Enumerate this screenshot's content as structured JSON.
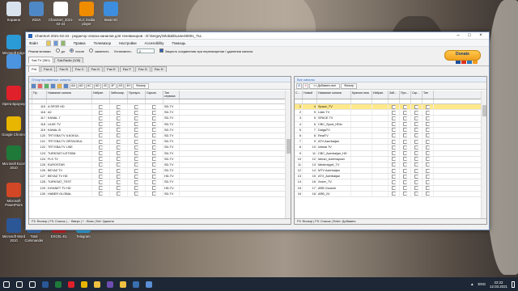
{
  "desktop": {
    "icons": [
      {
        "label": "Корзина",
        "color": "#d9e3ee"
      },
      {
        "label": "ИЗЗА",
        "color": "#4f88c6"
      },
      {
        "label": "ChanSort_2021-02-24",
        "color": "#ffffff"
      },
      {
        "label": "VLC media player",
        "color": "#f08c00"
      },
      {
        "label": "Киви HD",
        "color": "#3d8ede"
      },
      {
        "label": "Microsoft Edge",
        "color": "#2b9bd8"
      },
      {
        "label": "",
        "color": "#4d94e0"
      },
      {
        "label": "Opera Браузер",
        "color": "#e0202a"
      },
      {
        "label": "Google Chrome",
        "color": "#e8b500"
      },
      {
        "label": "Microsoft Excel 2010",
        "color": "#1f7a3a"
      },
      {
        "label": "Microsoft PowerPoint",
        "color": "#d24726"
      },
      {
        "label": "Microsoft Word 2010",
        "color": "#2b5797"
      },
      {
        "label": "Total Commander",
        "color": "#3a6fb0"
      },
      {
        "label": "EXCEL-EL",
        "color": "#c42121"
      },
      {
        "label": "Telegram",
        "color": "#2ea6df"
      }
    ]
  },
  "window": {
    "title": "ChanSort 2021-02-24 - редактор списка каналов для телевизоров - D:\\Sergey\\GlobalDLanes\\0001_TLL",
    "menu": [
      "Файл",
      "Правка",
      "Телевизор",
      "Настройки",
      "Accessibility",
      "Помощь"
    ],
    "options": {
      "mode_label": "Режим вставки",
      "radio_before": "до",
      "radio_after": "после",
      "radio_replace": "заменить",
      "set_label": "Установить:",
      "set_value": "2",
      "close_gaps": "Закрыть соединения при перемещении / удалении канала"
    },
    "donate": "Donate",
    "source_tabs": [
      "Sat-TV (381)",
      "Sat-Radio (108)"
    ],
    "fav_tabs": [
      "Pr#",
      "Fav A",
      "Fav B",
      "Fav C",
      "Fav D",
      "Fav E",
      "Fav F",
      "Fav G",
      "Fav H"
    ],
    "left": {
      "title": "Отсортированные каналы",
      "tool_labels": [
        "AA",
        "AD",
        "AC",
        "AD",
        "4C",
        "4F",
        "4G",
        "4H"
      ],
      "filter_label": "Фильтр",
      "columns": [
        "Пр.",
        "Название канала",
        "Избран.",
        "Заблокир.",
        "Пропуск.",
        "Скрыть",
        "Тип сервиса"
      ],
      "rows": [
        {
          "nr": "115",
          "name": "A SPOR HD",
          "type": "SD-TV"
        },
        {
          "nr": "116",
          "name": "A2",
          "type": "SD-TV"
        },
        {
          "nr": "117",
          "name": "KANAL 7",
          "type": "SD-TV"
        },
        {
          "nr": "118",
          "name": "ULKE TV",
          "type": "SD-TV"
        },
        {
          "nr": "119",
          "name": "KANAL B",
          "type": "SD-TV"
        },
        {
          "nr": "120",
          "name": "TRT EBA TV ILKOKUL",
          "type": "SD-TV"
        },
        {
          "nr": "121",
          "name": "TRT EBA TV ORTAOKUL",
          "type": "SD-TV"
        },
        {
          "nr": "122",
          "name": "TRT EBA TV LISE",
          "type": "SD-TV"
        },
        {
          "nr": "123",
          "name": "TURKSAT ILETISIM",
          "type": "SD-TV"
        },
        {
          "nr": "124",
          "name": "FLS TV",
          "type": "SD-TV"
        },
        {
          "nr": "125",
          "name": "EUROSTAR",
          "type": "SD-TV"
        },
        {
          "nr": "126",
          "name": "BEYAZ TV",
          "type": "SD-TV"
        },
        {
          "nr": "127",
          "name": "BEYAZ TV HD",
          "type": "HD-TV"
        },
        {
          "nr": "128",
          "name": "TURKSAT_TEST",
          "type": "SD-TV"
        },
        {
          "nr": "129",
          "name": "DIYANET TV HD",
          "type": "HD-TV"
        },
        {
          "nr": "130",
          "name": "HABER GLOBAL",
          "type": "SD-TV"
        }
      ],
      "status": "F3: Фильтр | F5: Список | - : Вверх | + : Вниз | Del: Удалить"
    },
    "right": {
      "title": "Все каналы",
      "add_label": "<< Добавить все",
      "filter_label": "Фильтр",
      "columns": [
        "С...",
        "Новый",
        "Название канала",
        "Краткое имя",
        "Избран.",
        "Заб...",
        "Про...",
        "Скр...",
        "Тип"
      ],
      "rows": [
        {
          "c": "1",
          "new": "4",
          "name": "Space_TV",
          "sel": true
        },
        {
          "c": "2",
          "new": "5",
          "name": "Lider TV"
        },
        {
          "c": "3",
          "new": "5",
          "name": "SPACE TV"
        },
        {
          "c": "4",
          "new": "6",
          "name": "CBC_Sport_HDtv"
        },
        {
          "c": "5",
          "new": "7",
          "name": "DalgaTV"
        },
        {
          "c": "6",
          "new": "8",
          "name": "RealTV"
        },
        {
          "c": "7",
          "new": "9",
          "name": "ATV Azerbaijan"
        },
        {
          "c": "8",
          "new": "10",
          "name": "Ictimai TV"
        },
        {
          "c": "9",
          "new": "11",
          "name": "CBC_Azerbaijan_HD"
        },
        {
          "c": "10",
          "new": "12",
          "name": "Idman_Azerbaycan"
        },
        {
          "c": "11",
          "new": "13",
          "name": "Medeniyyet_TV"
        },
        {
          "c": "12",
          "new": "14",
          "name": "MTV Azerbaijan"
        },
        {
          "c": "13",
          "new": "15",
          "name": "ATV_Azerbaijan"
        },
        {
          "c": "14",
          "new": "16",
          "name": "Xezer_TV"
        },
        {
          "c": "15",
          "new": "17",
          "name": "ARB Gunesh"
        },
        {
          "c": "16",
          "new": "18",
          "name": "ARB_24"
        }
      ],
      "status": "F3: Фильтр | F5: Список | Enter: Добавить"
    }
  },
  "taskbar": {
    "items": [
      "start-icon",
      "search-icon",
      "taskview-icon",
      "word-icon",
      "excel-icon",
      "opera-icon",
      "chrome-icon",
      "explorer-icon",
      "zip-icon",
      "folder-icon",
      "total-commander-icon",
      "chansort-icon"
    ],
    "lang": "ENG",
    "time": "22:22",
    "date": "12.03.2021"
  }
}
